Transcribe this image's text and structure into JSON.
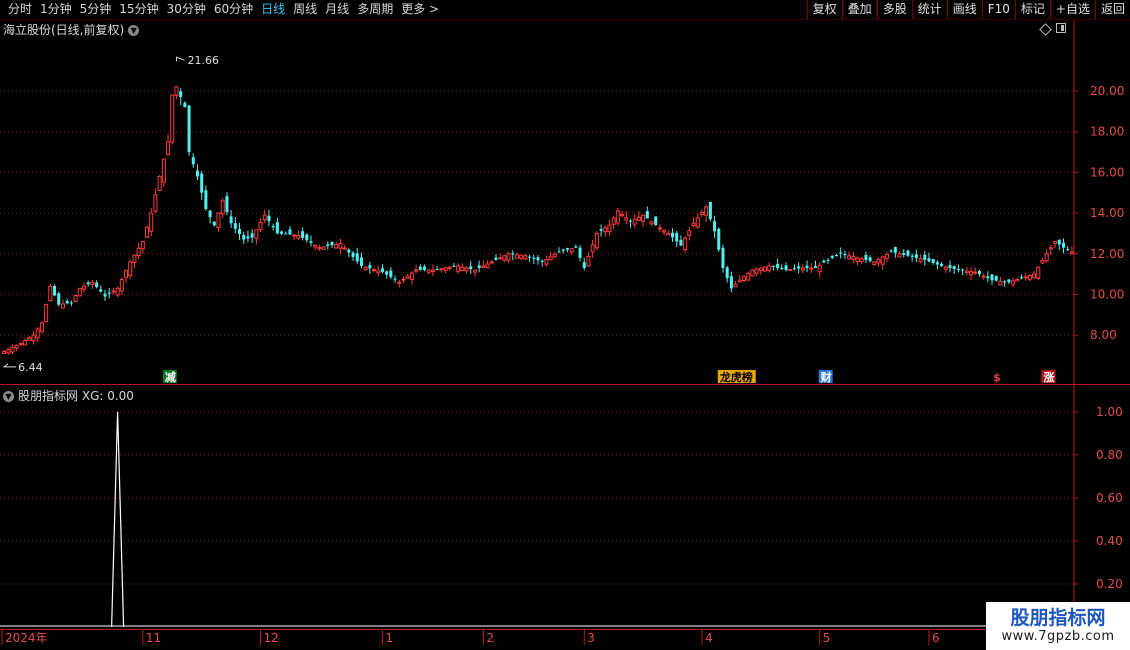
{
  "toolbar": {
    "periods": [
      "分时",
      "1分钟",
      "5分钟",
      "15分钟",
      "30分钟",
      "60分钟",
      "日线",
      "周线",
      "月线",
      "多周期",
      "更多 >"
    ],
    "active_index": 6,
    "buttons": [
      "复权",
      "叠加",
      "多股",
      "统计",
      "画线",
      "F10",
      "标记",
      "+自选",
      "返回"
    ]
  },
  "main_chart": {
    "title": "海立股份(日线,前复权)",
    "high_label": "21.66",
    "low_label": "6.44",
    "y_ticks": [
      "20.00",
      "18.00",
      "16.00",
      "14.00",
      "12.00",
      "10.00",
      "8.00"
    ],
    "y_tick_values": [
      20,
      18,
      16,
      14,
      12,
      10,
      8
    ],
    "price_range": [
      5.6,
      22.8
    ],
    "event_markers": [
      {
        "text": "减",
        "bg": "#0b7a24",
        "fg": "#ffffff",
        "bar_index": 38
      },
      {
        "text": "龙虎榜",
        "bg": "#e5a800",
        "fg": "#000000",
        "bar_index": 170
      },
      {
        "text": "财",
        "bg": "#2a78d8",
        "fg": "#ffffff",
        "bar_index": 194
      },
      {
        "text": "$",
        "bg": "#000000",
        "fg": "#e04040",
        "bar_index": 235
      },
      {
        "text": "涨",
        "bg": "#b01818",
        "fg": "#ffffff",
        "bar_index": 247
      }
    ],
    "colors": {
      "up": "#ff3b3b",
      "down": "#4ff0f0",
      "grid": "#7a1818",
      "axis": "#b71c1c"
    }
  },
  "indicator": {
    "title": "股朋指标网",
    "reading": "XG: 0.00",
    "y_ticks": [
      "1.00",
      "0.80",
      "0.60",
      "0.40",
      "0.20"
    ],
    "y_tick_values": [
      1.0,
      0.8,
      0.6,
      0.4,
      0.2
    ],
    "signal_bar_index": 27
  },
  "time_axis": {
    "labels": [
      {
        "text": "2024年",
        "bar_index": 0
      },
      {
        "text": "11",
        "bar_index": 33
      },
      {
        "text": "12",
        "bar_index": 61
      },
      {
        "text": "1",
        "bar_index": 90
      },
      {
        "text": "2",
        "bar_index": 114
      },
      {
        "text": "3",
        "bar_index": 138
      },
      {
        "text": "4",
        "bar_index": 166
      },
      {
        "text": "5",
        "bar_index": 194
      },
      {
        "text": "6",
        "bar_index": 220
      }
    ]
  },
  "chart_data": {
    "type": "candlestick",
    "bar_count": 255,
    "anchor_closes": [
      [
        0,
        7.2
      ],
      [
        4,
        7.6
      ],
      [
        7,
        8.0
      ],
      [
        9,
        8.6
      ],
      [
        11,
        10.4
      ],
      [
        13,
        9.5
      ],
      [
        16,
        9.6
      ],
      [
        18,
        10.3
      ],
      [
        21,
        10.6
      ],
      [
        24,
        9.9
      ],
      [
        27,
        10.3
      ],
      [
        30,
        11.6
      ],
      [
        33,
        12.6
      ],
      [
        35,
        14.0
      ],
      [
        37,
        15.8
      ],
      [
        39,
        17.5
      ],
      [
        40,
        19.8
      ],
      [
        41,
        20.2
      ],
      [
        43,
        19.2
      ],
      [
        44,
        17.0
      ],
      [
        46,
        15.8
      ],
      [
        48,
        14.2
      ],
      [
        50,
        13.4
      ],
      [
        52,
        14.6
      ],
      [
        54,
        13.5
      ],
      [
        57,
        12.7
      ],
      [
        59,
        12.8
      ],
      [
        62,
        13.9
      ],
      [
        65,
        13.0
      ],
      [
        70,
        12.9
      ],
      [
        75,
        12.3
      ],
      [
        80,
        12.5
      ],
      [
        85,
        11.4
      ],
      [
        90,
        11.1
      ],
      [
        94,
        10.6
      ],
      [
        98,
        11.2
      ],
      [
        102,
        11.2
      ],
      [
        108,
        11.4
      ],
      [
        112,
        11.2
      ],
      [
        116,
        11.6
      ],
      [
        120,
        12.0
      ],
      [
        124,
        11.9
      ],
      [
        128,
        11.6
      ],
      [
        132,
        12.1
      ],
      [
        136,
        12.3
      ],
      [
        138,
        11.3
      ],
      [
        141,
        13.0
      ],
      [
        144,
        13.4
      ],
      [
        146,
        14.1
      ],
      [
        149,
        13.6
      ],
      [
        152,
        13.9
      ],
      [
        155,
        13.4
      ],
      [
        158,
        13.0
      ],
      [
        161,
        12.4
      ],
      [
        164,
        13.5
      ],
      [
        167,
        14.3
      ],
      [
        169,
        13.1
      ],
      [
        171,
        11.3
      ],
      [
        173,
        10.3
      ],
      [
        175,
        10.7
      ],
      [
        178,
        11.2
      ],
      [
        182,
        11.4
      ],
      [
        186,
        11.2
      ],
      [
        190,
        11.3
      ],
      [
        193,
        11.3
      ],
      [
        196,
        11.7
      ],
      [
        199,
        12.0
      ],
      [
        203,
        11.8
      ],
      [
        207,
        11.6
      ],
      [
        211,
        12.1
      ],
      [
        215,
        11.9
      ],
      [
        219,
        11.7
      ],
      [
        223,
        11.4
      ],
      [
        227,
        11.2
      ],
      [
        231,
        11.1
      ],
      [
        235,
        10.7
      ],
      [
        239,
        10.6
      ],
      [
        242,
        10.8
      ],
      [
        245,
        11.0
      ],
      [
        248,
        12.0
      ],
      [
        250,
        12.6
      ],
      [
        252,
        12.3
      ],
      [
        254,
        12.1
      ]
    ],
    "indicator_series": {
      "name": "XG",
      "signal_bar_index": 27,
      "signal_value": 1.0
    }
  }
}
